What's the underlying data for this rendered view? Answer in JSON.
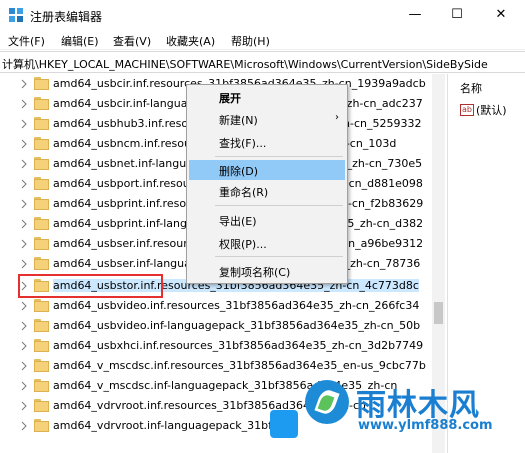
{
  "window": {
    "title": "注册表编辑器",
    "minimize_glyph": "—",
    "maximize_glyph": "☐",
    "close_glyph": "✕"
  },
  "menu": [
    "文件(F)",
    "编辑(E)",
    "查看(V)",
    "收藏夹(A)",
    "帮助(H)"
  ],
  "address": "计算机\\HKEY_LOCAL_MACHINE\\SOFTWARE\\Microsoft\\Windows\\CurrentVersion\\SideBySide",
  "tree_rows": [
    "amd64_usbcir.inf.resources_31bf3856ad364e35_zh-cn_1939a9adcb",
    "amd64_usbcir.inf-languagepack_31bf3856ad364e35_zh-cn_adc237",
    "amd64_usbhub3.inf.resources_31bf3856ad364e35_zh-cn_5259332",
    "amd64_usbncm.inf.resources_31bf3856ad364e35_zh-cn_103d",
    "amd64_usbnet.inf-languagepack_31bf3856ad364e35_zh-cn_730e5",
    "amd64_usbport.inf.resources_31bf3856ad364e35_zh-cn_d881e098",
    "amd64_usbprint.inf.resources_31bf3856ad364e35_zh-cn_f2b83629",
    "amd64_usbprint.inf-languagepack_31bf3856ad364e35_zh-cn_d382",
    "amd64_usbser.inf.resources_31bf3856ad364e35_zh-cn_a96be9312",
    "amd64_usbser.inf-languagepack_31bf3856ad364e35_zh-cn_78736",
    "amd64_usbstor.inf.resources_31bf3856ad364e35_zh-cn_4c773d8c",
    "amd64_usbvideo.inf.resources_31bf3856ad364e35_zh-cn_266fc34",
    "amd64_usbvideo.inf-languagepack_31bf3856ad364e35_zh-cn_50b",
    "amd64_usbxhci.inf.resources_31bf3856ad364e35_zh-cn_3d2b7749",
    "amd64_v_mscdsc.inf.resources_31bf3856ad364e35_en-us_9cbc77b",
    "amd64_v_mscdsc.inf-languagepack_31bf3856ad364e35_zh-cn",
    "amd64_vdrvroot.inf.resources_31bf3856ad364e35_zh-cn",
    "amd64_vdrvroot.inf-languagepack_31bf"
  ],
  "right_pane": {
    "header": "名称",
    "value_icon": "ab",
    "value_name": "(默认)"
  },
  "context_menu": {
    "expand": "展开",
    "new": "新建(N)",
    "new_arrow": "›",
    "find": "查找(F)...",
    "delete": "删除(D)",
    "rename": "重命名(R)",
    "export": "导出(E)",
    "permissions": "权限(P)...",
    "copy_key_name": "复制项名称(C)"
  },
  "watermark": {
    "brand": "雨林木风",
    "url": "www.ylmf888.com"
  },
  "colors": {
    "selection": "#cce8ff",
    "menu_highlight": "#91c9f7",
    "callout": "#e53030",
    "brand_blue": "#1a7fd0"
  }
}
